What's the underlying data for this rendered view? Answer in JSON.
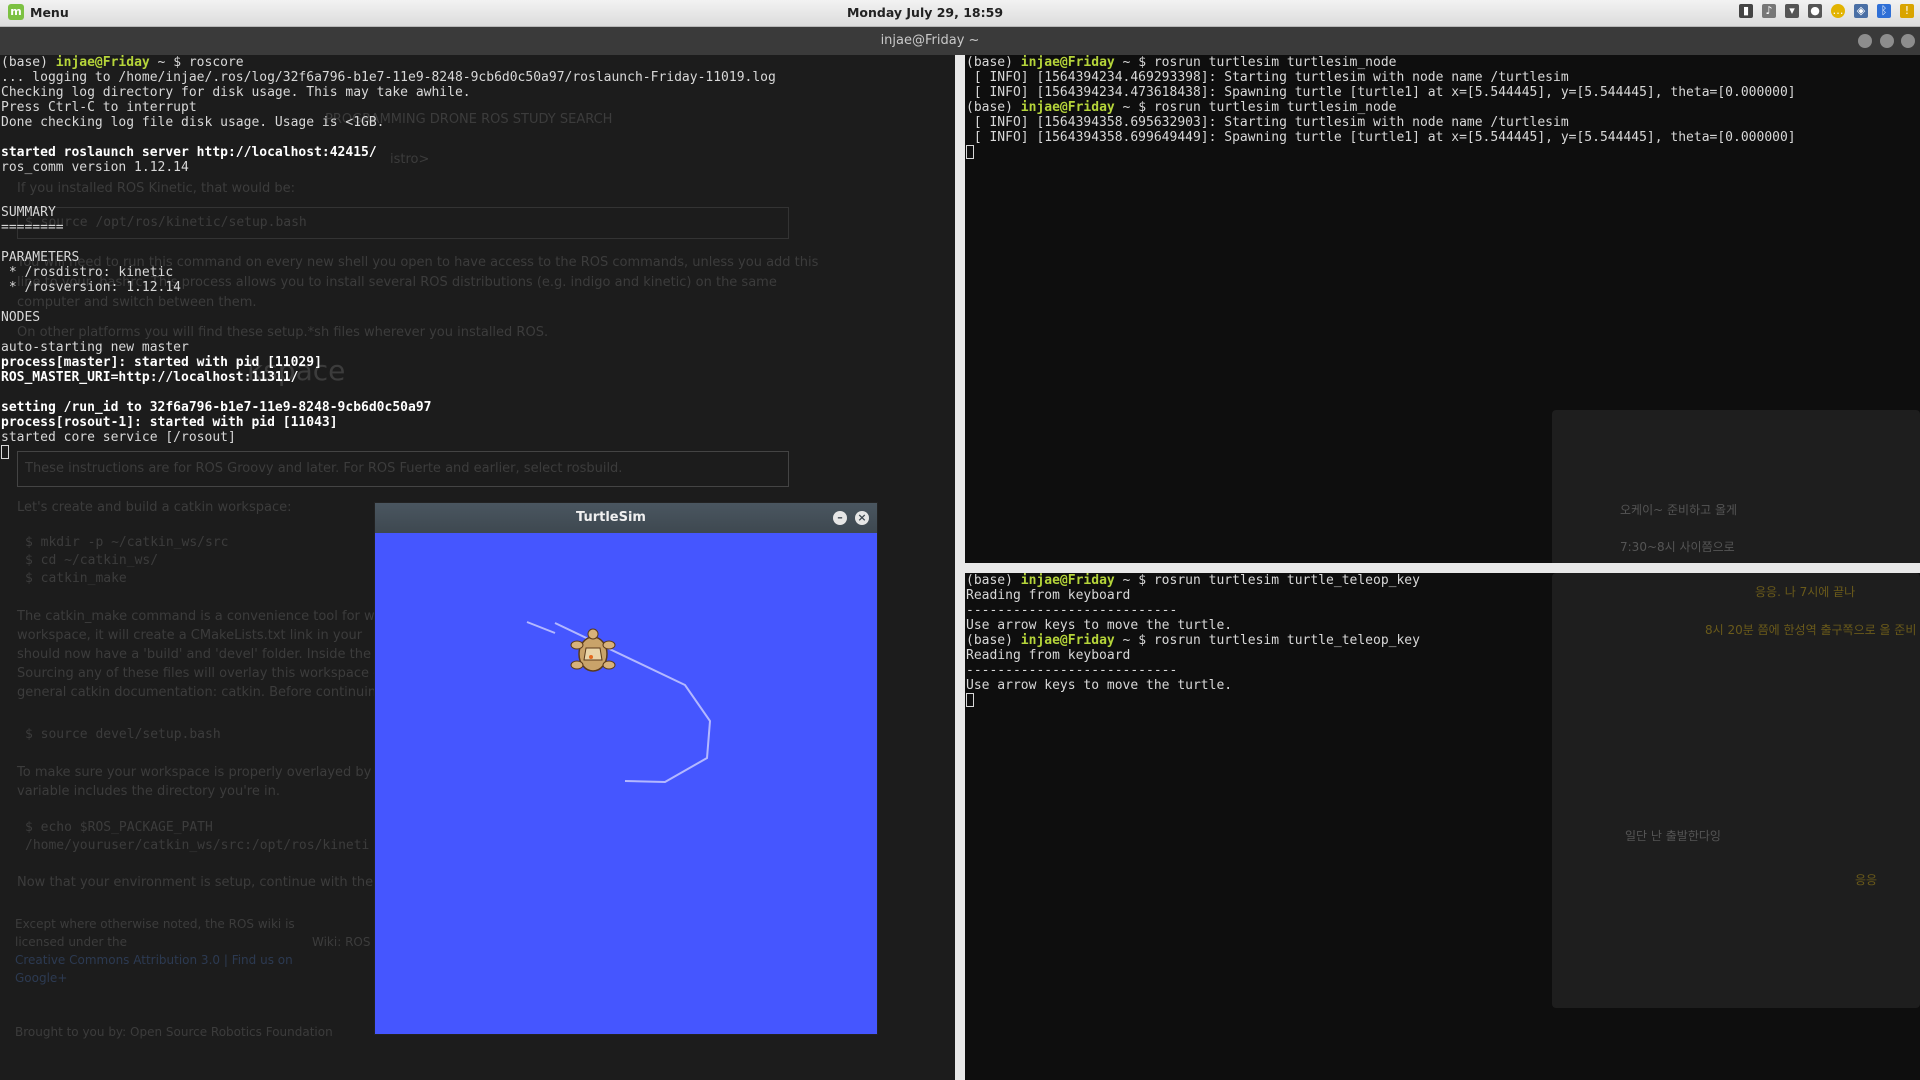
{
  "panel": {
    "menu_label": "Menu",
    "clock": "Monday July 29, 18:59"
  },
  "window": {
    "title": "injae@Friday ~"
  },
  "left_terminal": {
    "lines": [
      {
        "parts": [
          {
            "t": "(base) "
          },
          {
            "t": "injae@Friday",
            "c": "user"
          },
          {
            "t": " ~ $ roscore"
          }
        ]
      },
      {
        "parts": [
          {
            "t": "... logging to /home/injae/.ros/log/32f6a796-b1e7-11e9-8248-9cb6d0c50a97/roslaunch-Friday-11019.log"
          }
        ]
      },
      {
        "parts": [
          {
            "t": "Checking log directory for disk usage. This may take awhile."
          }
        ]
      },
      {
        "parts": [
          {
            "t": "Press Ctrl-C to interrupt"
          }
        ]
      },
      {
        "parts": [
          {
            "t": "Done checking log file disk usage. Usage is <1GB."
          }
        ]
      },
      {
        "parts": [
          {
            "t": ""
          }
        ]
      },
      {
        "parts": [
          {
            "t": "started roslaunch server http://localhost:42415/",
            "c": "b"
          }
        ]
      },
      {
        "parts": [
          {
            "t": "ros_comm version 1.12.14"
          }
        ]
      },
      {
        "parts": [
          {
            "t": ""
          }
        ]
      },
      {
        "parts": [
          {
            "t": ""
          }
        ]
      },
      {
        "parts": [
          {
            "t": "SUMMARY"
          }
        ]
      },
      {
        "parts": [
          {
            "t": "========"
          }
        ]
      },
      {
        "parts": [
          {
            "t": ""
          }
        ]
      },
      {
        "parts": [
          {
            "t": "PARAMETERS"
          }
        ]
      },
      {
        "parts": [
          {
            "t": " * /rosdistro: kinetic"
          }
        ]
      },
      {
        "parts": [
          {
            "t": " * /rosversion: 1.12.14"
          }
        ]
      },
      {
        "parts": [
          {
            "t": ""
          }
        ]
      },
      {
        "parts": [
          {
            "t": "NODES"
          }
        ]
      },
      {
        "parts": [
          {
            "t": ""
          }
        ]
      },
      {
        "parts": [
          {
            "t": "auto-starting new master"
          }
        ]
      },
      {
        "parts": [
          {
            "t": "process[master]: started with pid [11029]",
            "c": "b"
          }
        ]
      },
      {
        "parts": [
          {
            "t": "ROS_MASTER_URI=http://localhost:11311/",
            "c": "b"
          }
        ]
      },
      {
        "parts": [
          {
            "t": ""
          }
        ]
      },
      {
        "parts": [
          {
            "t": "setting /run_id to 32f6a796-b1e7-11e9-8248-9cb6d0c50a97",
            "c": "b"
          }
        ]
      },
      {
        "parts": [
          {
            "t": "process[rosout-1]: started with pid [11043]",
            "c": "b"
          }
        ]
      },
      {
        "parts": [
          {
            "t": "started core service [/rosout]"
          }
        ]
      }
    ]
  },
  "top_right_terminal": {
    "lines": [
      {
        "parts": [
          {
            "t": "(base) "
          },
          {
            "t": "injae@Friday",
            "c": "user"
          },
          {
            "t": " ~ $ rosrun turtlesim turtlesim_node"
          }
        ]
      },
      {
        "parts": [
          {
            "t": " [ INFO] [1564394234.469293398]: Starting turtlesim with node name /turtlesim"
          }
        ]
      },
      {
        "parts": [
          {
            "t": " [ INFO] [1564394234.473618438]: Spawning turtle [turtle1] at x=[5.544445], y=[5.544445], theta=[0.000000]"
          }
        ]
      },
      {
        "parts": [
          {
            "t": "(base) "
          },
          {
            "t": "injae@Friday",
            "c": "user"
          },
          {
            "t": " ~ $ rosrun turtlesim turtlesim_node"
          }
        ]
      },
      {
        "parts": [
          {
            "t": " [ INFO] [1564394358.695632903]: Starting turtlesim with node name /turtlesim"
          }
        ]
      },
      {
        "parts": [
          {
            "t": " [ INFO] [1564394358.699649449]: Spawning turtle [turtle1] at x=[5.544445], y=[5.544445], theta=[0.000000]"
          }
        ]
      }
    ]
  },
  "bottom_right_terminal": {
    "lines": [
      {
        "parts": [
          {
            "t": "(base) "
          },
          {
            "t": "injae@Friday",
            "c": "user"
          },
          {
            "t": " ~ $ rosrun turtlesim turtle_teleop_key"
          }
        ]
      },
      {
        "parts": [
          {
            "t": "Reading from keyboard"
          }
        ]
      },
      {
        "parts": [
          {
            "t": "---------------------------"
          }
        ]
      },
      {
        "parts": [
          {
            "t": "Use arrow keys to move the turtle."
          }
        ]
      },
      {
        "parts": [
          {
            "t": "(base) "
          },
          {
            "t": "injae@Friday",
            "c": "user"
          },
          {
            "t": " ~ $ rosrun turtlesim turtle_teleop_key"
          }
        ]
      },
      {
        "parts": [
          {
            "t": "Reading from keyboard"
          }
        ]
      },
      {
        "parts": [
          {
            "t": "---------------------------"
          }
        ]
      },
      {
        "parts": [
          {
            "t": "Use arrow keys to move the turtle."
          }
        ]
      }
    ]
  },
  "turtlesim": {
    "title": "TurtleSim",
    "background_color": "#4556ff",
    "pen_color": "#b3b8ff"
  },
  "ghost_text": {
    "bookmarks": "PROGRAMMING    DRONE    ROS    STUDY    SEARCH",
    "istro": "istro>",
    "kinetic_note": "If you installed ROS Kinetic, that would be:",
    "setup_cmd": "$ source /opt/ros/kinetic/setup.bash",
    "shell_note": "You will need to run this command on every new shell you open to have access to the ROS commands, unless you add this",
    "distro_note": "line to your .bashrc. This process allows you to install several ROS distributions (e.g. indigo and kinetic) on the same",
    "switch_note": "computer and switch between them.",
    "platforms_note": "On other platforms you will find these setup.*sh files wherever you installed ROS.",
    "workspace_heading": "kspace",
    "groovy_note": "These instructions are for ROS Groovy and later. For ROS Fuerte and earlier, select rosbuild.",
    "create_note": "Let's create and build a catkin workspace:",
    "mkdir": "$ mkdir -p ~/catkin_ws/src",
    "cd": "$ cd ~/catkin_ws/",
    "catkin_make": "$ catkin_make",
    "convenience": "The catkin_make command is a convenience tool for wor",
    "cmakelists": "workspace, it will create a CMakeLists.txt link in your",
    "build_devel": "should now have a 'build' and 'devel' folder. Inside the 'de",
    "sourcing": "Sourcing any of these files will overlay this workspace on",
    "general": "general catkin documentation: catkin. Before continuing s",
    "source_devel": "$ source devel/setup.bash",
    "overlay": "To make sure your workspace is properly overlayed by th",
    "variable": "variable includes the directory you're in.",
    "echo_path": "$ echo $ROS_PACKAGE_PATH",
    "pkg_path": "/home/youruser/catkin_ws/src:/opt/ros/kineti",
    "now": "Now that your environment is setup, continue with the RO",
    "footer1": "Except where otherwise noted, the ROS wiki is",
    "footer2": "licensed under the",
    "footer3": "Creative Commons Attribution 3.0 | Find us on",
    "footer4": "Google+",
    "wiki": "Wiki: ROS",
    "brought": "Brought to you by:   Open Source Robotics Foundation",
    "chat_msg1": "오케이~ 준비하고 올게",
    "chat_msg2": "7:30~8시 사이쯤으로",
    "chat_msg3": "응응. 나 7시에 끝나",
    "chat_msg4": "8시 20분 쯤에 한성역 출구쪽으로 올 준비",
    "chat_msg5": "일단 난 출발한다잉",
    "chat_msg6": "응응"
  }
}
